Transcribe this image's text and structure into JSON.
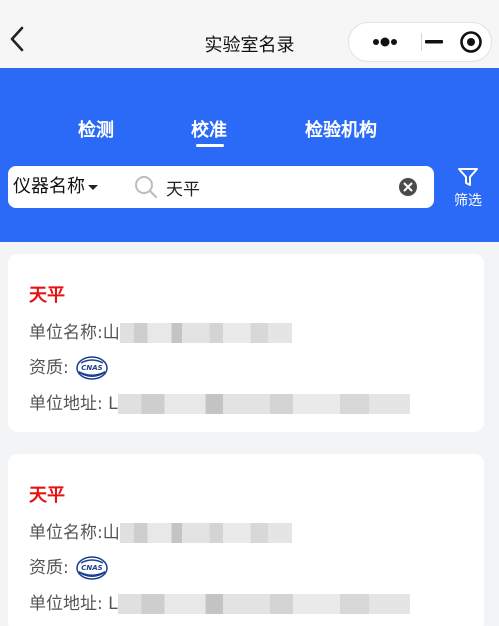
{
  "navbar": {
    "title": "实验室名录"
  },
  "tabs": [
    {
      "label": "检测",
      "active": false
    },
    {
      "label": "校准",
      "active": true
    },
    {
      "label": "检验机构",
      "active": false
    }
  ],
  "search": {
    "type_label": "仪器名称",
    "value": "天平"
  },
  "filter": {
    "label": "筛选"
  },
  "labels": {
    "unit_name": "单位名称:",
    "qualification": "资质:",
    "unit_address": "单位地址:"
  },
  "results": [
    {
      "title": "天平",
      "name_visible": "山",
      "address_visible": "L",
      "qualification_badge": "CNAS"
    },
    {
      "title": "天平",
      "name_visible": "山",
      "address_visible": "L",
      "qualification_badge": "CNAS"
    }
  ],
  "colors": {
    "brand_blue": "#2a6af7",
    "title_red": "#e51212",
    "page_bg": "#f3f4f6"
  },
  "icons": [
    "back-icon",
    "more-dots-icon",
    "minimize-icon",
    "close-target-icon",
    "search-icon",
    "clear-icon",
    "filter-icon",
    "cnas-badge-icon"
  ]
}
